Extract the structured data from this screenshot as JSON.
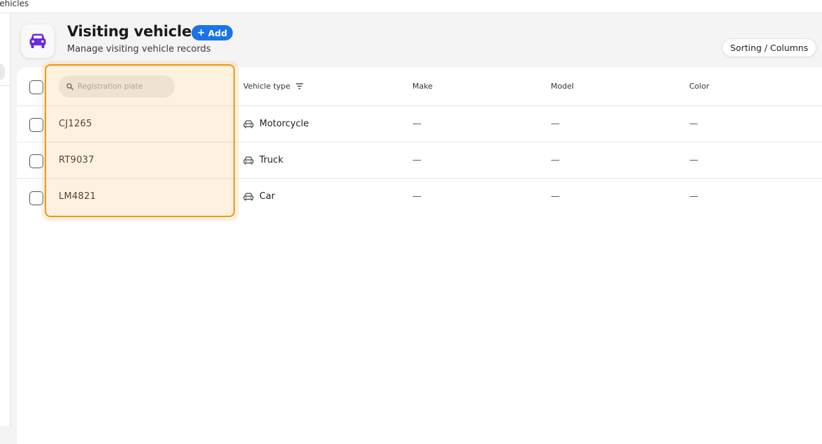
{
  "window": {
    "title": "Vehicles"
  },
  "header": {
    "title": "Visiting vehicles",
    "subtitle": "Manage visiting vehicle records",
    "add_label": "Add",
    "sort_label": "Sorting / Columns",
    "icon": "car-icon",
    "accent_color": "#6a2ae0"
  },
  "table": {
    "search_placeholder": "Registration plate",
    "search_value": "",
    "columns": [
      "Vehicle type",
      "Make",
      "Model",
      "Color"
    ],
    "rows": [
      {
        "plate": "CJ1265",
        "vehicle_type": "Motorcycle",
        "make": "—",
        "model": "—",
        "color": "—"
      },
      {
        "plate": "RT9037",
        "vehicle_type": "Truck",
        "make": "—",
        "model": "—",
        "color": "—"
      },
      {
        "plate": "LM4821",
        "vehicle_type": "Car",
        "make": "—",
        "model": "—",
        "color": "—"
      }
    ]
  },
  "colors": {
    "add_button": "#1a73e8",
    "highlight": "#f2960f"
  }
}
